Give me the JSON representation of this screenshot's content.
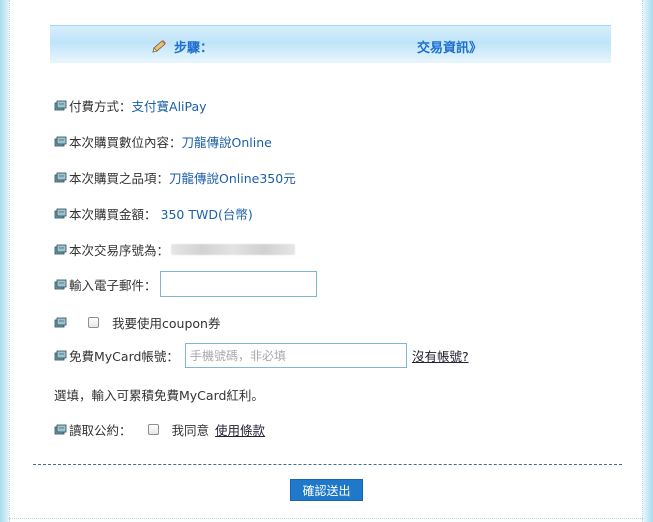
{
  "header": {
    "step_label": "步驟：",
    "step_current": "交易資訊》"
  },
  "fields": {
    "payment_method_label": "付費方式：",
    "payment_method_value": "支付寶AliPay",
    "content_label": "本次購買數位內容：",
    "content_value": "刀龍傳說Online",
    "item_label": "本次購買之品項：",
    "item_value": "刀龍傳說Online350元",
    "amount_label": "本次購買金額：",
    "amount_value": " 350 TWD(台幣)",
    "txn_label": "本次交易序號為：",
    "email_label": "輸入電子郵件：",
    "email_value": "",
    "coupon_label": "我要使用coupon券",
    "mycard_label": "免費MyCard帳號：",
    "mycard_placeholder": "手機號碼，非必填",
    "no_account_link": "沒有帳號?",
    "note": "選填，輸入可累積免費MyCard紅利。",
    "terms_label": "讀取公約：",
    "agree_label": "我同意",
    "terms_link": "使用條款"
  },
  "actions": {
    "submit_label": "確認送出"
  },
  "icons": {
    "step": "pencil-icon",
    "bullet": "book-icon"
  },
  "colors": {
    "accent": "#1e6fd0",
    "button": "#1f78c9",
    "value_text": "#1b5fa8"
  }
}
